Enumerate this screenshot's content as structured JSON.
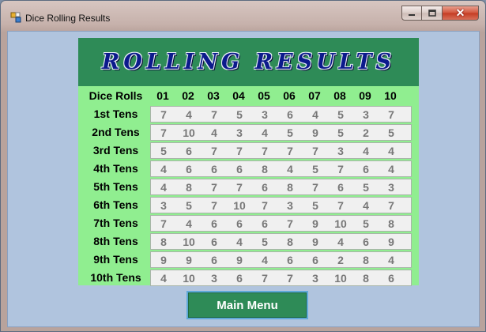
{
  "window": {
    "title": "Dice Rolling Results"
  },
  "banner": {
    "text": "ROLLING RESULTS"
  },
  "header": {
    "label": "Dice Rolls",
    "columns": [
      "01",
      "02",
      "03",
      "04",
      "05",
      "06",
      "07",
      "08",
      "09",
      "10"
    ]
  },
  "rows": [
    {
      "label": "1st Tens",
      "values": [
        "7",
        "4",
        "7",
        "5",
        "3",
        "6",
        "4",
        "5",
        "3",
        "7"
      ]
    },
    {
      "label": "2nd Tens",
      "values": [
        "7",
        "10",
        "4",
        "3",
        "4",
        "5",
        "9",
        "5",
        "2",
        "5"
      ]
    },
    {
      "label": "3rd Tens",
      "values": [
        "5",
        "6",
        "7",
        "7",
        "7",
        "7",
        "7",
        "3",
        "4",
        "4"
      ]
    },
    {
      "label": "4th Tens",
      "values": [
        "4",
        "6",
        "6",
        "6",
        "8",
        "4",
        "5",
        "7",
        "6",
        "4"
      ]
    },
    {
      "label": "5th Tens",
      "values": [
        "4",
        "8",
        "7",
        "7",
        "6",
        "8",
        "7",
        "6",
        "5",
        "3"
      ]
    },
    {
      "label": "6th Tens",
      "values": [
        "3",
        "5",
        "7",
        "10",
        "7",
        "3",
        "5",
        "7",
        "4",
        "7"
      ]
    },
    {
      "label": "7th Tens",
      "values": [
        "7",
        "4",
        "6",
        "6",
        "6",
        "7",
        "9",
        "10",
        "5",
        "8"
      ]
    },
    {
      "label": "8th Tens",
      "values": [
        "8",
        "10",
        "6",
        "4",
        "5",
        "8",
        "9",
        "4",
        "6",
        "9"
      ]
    },
    {
      "label": "9th Tens",
      "values": [
        "9",
        "9",
        "6",
        "9",
        "4",
        "6",
        "6",
        "2",
        "8",
        "4"
      ]
    },
    {
      "label": "10th Tens",
      "values": [
        "4",
        "10",
        "3",
        "6",
        "7",
        "7",
        "3",
        "10",
        "8",
        "6"
      ]
    }
  ],
  "buttons": {
    "main_menu": "Main Menu"
  },
  "colors": {
    "panel": "#90ee90",
    "banner": "#2e8b57",
    "client": "#b0c4de",
    "banner_text": "#0c1a8c"
  }
}
